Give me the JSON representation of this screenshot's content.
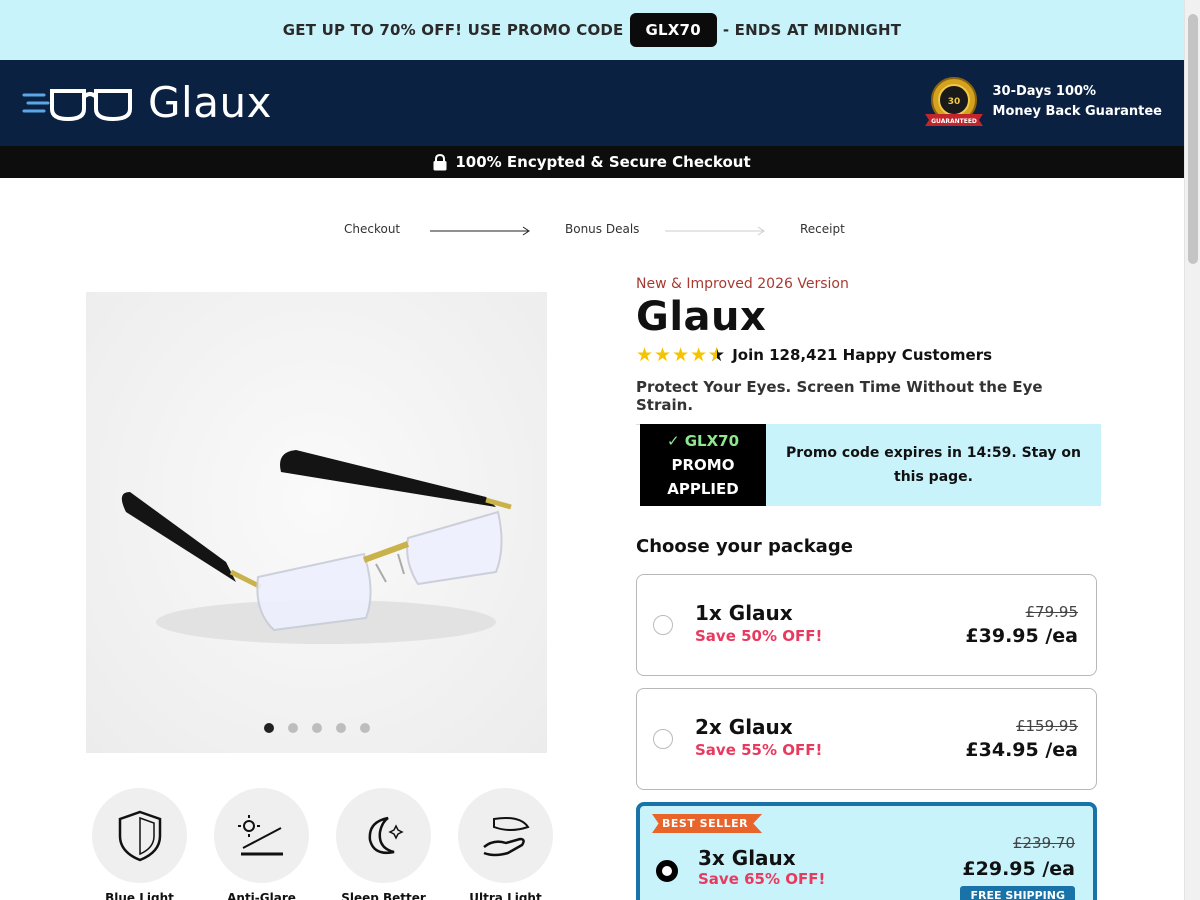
{
  "promo_bar": {
    "text_before": "GET UP TO 70% OFF! USE PROMO CODE",
    "code": "GLX70",
    "text_after": "- ENDS AT MIDNIGHT"
  },
  "header": {
    "brand": "Glaux",
    "guarantee_line1": "30-Days 100%",
    "guarantee_line2": "Money Back Guarantee",
    "badge_text": "30 DAY"
  },
  "secure_bar": {
    "label": "100% Encypted & Secure Checkout"
  },
  "steps": [
    {
      "label": "Checkout"
    },
    {
      "label": "Bonus Deals"
    },
    {
      "label": "Receipt"
    }
  ],
  "gallery": {
    "dots": 5,
    "active_index": 0
  },
  "features": [
    {
      "icon": "shield-icon",
      "label": "Blue Light"
    },
    {
      "icon": "sun-glare-icon",
      "label": "Anti-Glare"
    },
    {
      "icon": "moon-sleep-icon",
      "label": "Sleep Better"
    },
    {
      "icon": "feather-hand-icon",
      "label": "Ultra Light"
    }
  ],
  "product": {
    "version": "New & Improved 2026 Version",
    "title": "Glaux",
    "rating_text": "Join 128,421 Happy Customers",
    "rating_value": 4.5,
    "tagline": "Protect Your Eyes. Screen Time Without the Eye Strain."
  },
  "promo_box": {
    "code_line": "✓ GLX70",
    "line2": "PROMO",
    "line3": "APPLIED",
    "expire_text": "Promo code expires in 14:59. Stay on this page."
  },
  "packages_heading": "Choose your package",
  "packages": [
    {
      "name": "1x Glaux",
      "save": "Save 50% OFF!",
      "old_price": "£79.95",
      "price": "£39.95 /ea"
    },
    {
      "name": "2x Glaux",
      "save": "Save 55% OFF!",
      "old_price": "£159.95",
      "price": "£34.95 /ea"
    },
    {
      "name": "3x Glaux",
      "save": "Save 65% OFF!",
      "old_price": "£239.70",
      "price": "£29.95 /ea",
      "badge": "BEST SELLER",
      "shipping": "FREE SHIPPING"
    }
  ],
  "colors": {
    "promo_bg": "#c8f3fb",
    "header_bg": "#0a2142",
    "accent_red": "#e83a5f",
    "best_border": "#1a73a8",
    "badge_orange": "#e9642a"
  }
}
